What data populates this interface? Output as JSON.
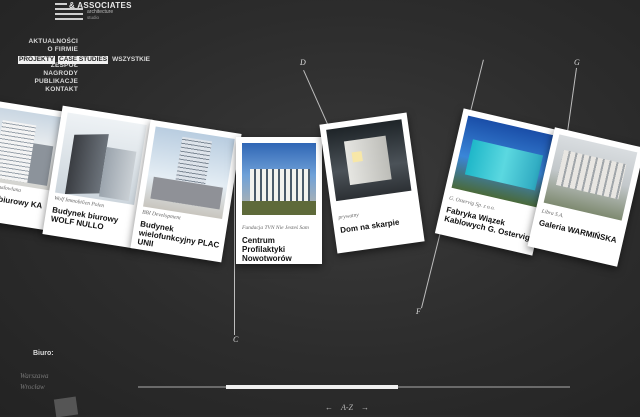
{
  "logo": {
    "name": "& ASSOCIATES",
    "line1": "architecture",
    "line2": "studio"
  },
  "nav": {
    "items": [
      "AKTUALNOŚCI",
      "O FIRMIE",
      "PROJEKTY",
      "CASE STUDIES",
      "WSZYSTKIE",
      "ZESPÓŁ",
      "NAGRODY",
      "PUBLIKACJE",
      "KONTAKT"
    ]
  },
  "cards": [
    {
      "client": "Polska Grupa Budowlana",
      "title": "Budynek biurowy KA"
    },
    {
      "client": "Wolf Immobilien Polen",
      "title": "Budynek biurowy WOLF NULLO"
    },
    {
      "client": "BBI Development",
      "title": "Budynek wielofunkcyjny PLAC UNII"
    },
    {
      "client": "Fundacja TVN Nie Jesteś Sam",
      "title": "Centrum Profilaktyki Nowotworów"
    },
    {
      "client": "prywatny",
      "title": "Dom na skarpie"
    },
    {
      "client": "G. Ostervig Sp. z o.o.",
      "title": "Fabryka Wiązek Kablowych G. Ostervig"
    },
    {
      "client": "Libra S.A.",
      "title": "Galeria WARMIŃSKA"
    }
  ],
  "letters": {
    "c": "C",
    "d": "D",
    "f": "F",
    "g": "G"
  },
  "footer": {
    "biuro": "Biuro:",
    "office1": "Warszawa",
    "office2": "Wrocław",
    "az": "A-Z",
    "prev": "←",
    "next": "→"
  },
  "colors": {
    "background": "#2c2c2c",
    "card": "#ffffff",
    "accent": "#f0f0f0"
  }
}
